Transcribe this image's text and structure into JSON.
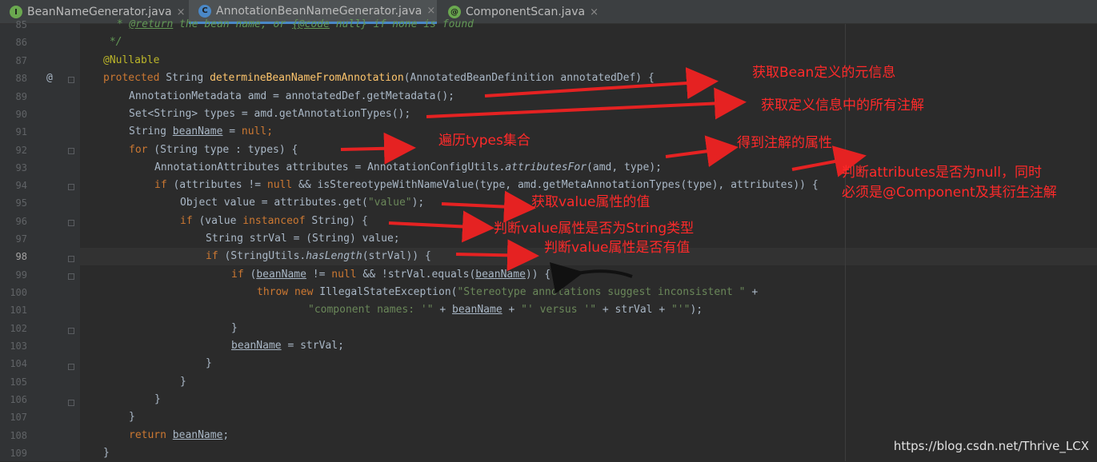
{
  "tabs": [
    {
      "label": "BeanNameGenerator.java",
      "icon": "interface-icon",
      "icon_letter": "I",
      "icon_color": "#6aa84f"
    },
    {
      "label": "AnnotationBeanNameGenerator.java",
      "icon": "class-icon",
      "icon_letter": "C",
      "icon_color": "#4a88c7"
    },
    {
      "label": "ComponentScan.java",
      "icon": "annotation-icon",
      "icon_letter": "@",
      "icon_color": "#6aa84f"
    }
  ],
  "tab_close": "×",
  "line_numbers": [
    "85",
    "86",
    "87",
    "88",
    "89",
    "90",
    "91",
    "92",
    "93",
    "94",
    "95",
    "96",
    "97",
    "98",
    "99",
    "100",
    "101",
    "102",
    "103",
    "104",
    "105",
    "106",
    "107",
    "108",
    "109"
  ],
  "gutter_marker": "@",
  "code": {
    "l85a": " * ",
    "l85b": "@return",
    "l85c": " the bean name, or ",
    "l85d": "{@code",
    "l85e": " null} if none is found",
    "l86": " */",
    "l87": "@Nullable",
    "l88a": "protected",
    "l88b": " String ",
    "l88c": "determineBeanNameFromAnnotation",
    "l88d": "(AnnotatedBeanDefinition annotatedDef) {",
    "l89": "AnnotationMetadata amd = annotatedDef.getMetadata();",
    "l90": "Set<String> types = amd.getAnnotationTypes();",
    "l91a": "String ",
    "l91b": "beanName",
    "l91c": " = ",
    "l91d": "null",
    "l91e": ";",
    "l92a": "for",
    "l92b": " (String type : types) {",
    "l93a": "AnnotationAttributes attributes = AnnotationConfigUtils.",
    "l93b": "attributesFor",
    "l93c": "(amd, type);",
    "l94a": "if",
    "l94b": " (attributes != ",
    "l94c": "null",
    "l94d": " && isStereotypeWithNameValue(type, amd.getMetaAnnotationTypes(type), attributes)) {",
    "l95a": "Object value = attributes.get(",
    "l95b": "\"value\"",
    "l95c": ");",
    "l96a": "if",
    "l96b": " (value ",
    "l96c": "instanceof",
    "l96d": " String) {",
    "l97": "String strVal = (String) value;",
    "l98a": "if",
    "l98b": " (StringUtils.",
    "l98c": "hasLength",
    "l98d": "(strVal)) {",
    "l99a": "if",
    "l99b": " (",
    "l99c": "beanName",
    "l99d": " != ",
    "l99e": "null",
    "l99f": " && !strVal.equals(",
    "l99g": "beanName",
    "l99h": ")) {",
    "l100a": "throw new",
    "l100b": " IllegalStateException(",
    "l100c": "\"Stereotype annotations suggest inconsistent \"",
    "l100d": " +",
    "l101a": "\"component names: '\"",
    "l101b": " + ",
    "l101c": "beanName",
    "l101d": " + ",
    "l101e": "\"' versus '\"",
    "l101f": " + strVal + ",
    "l101g": "\"'\"",
    "l101h": ");",
    "l102": "}",
    "l103a": "beanName",
    "l103b": " = strVal;",
    "l104": "}",
    "l105": "}",
    "l106": "}",
    "l107": "}",
    "l108a": "return",
    "l108b": " ",
    "l108c": "beanName",
    "l108d": ";",
    "l109": "}"
  },
  "annotations": [
    "获取Bean定义的元信息",
    "获取定义信息中的所有注解",
    "遍历types集合",
    "得到注解的属性",
    "判断attributes是否为null，同时",
    "必须是@Component及其衍生注解",
    "获取value属性的值",
    "判断value属性是否为String类型",
    "判断value属性是否有值"
  ],
  "watermark": "https://blog.csdn.net/Thrive_LCX",
  "colors": {
    "annotation_red": "#ff2a2a",
    "editor_bg": "#2b2b2b",
    "keyword": "#cc7832",
    "method": "#ffc66d",
    "string": "#6a8759"
  }
}
